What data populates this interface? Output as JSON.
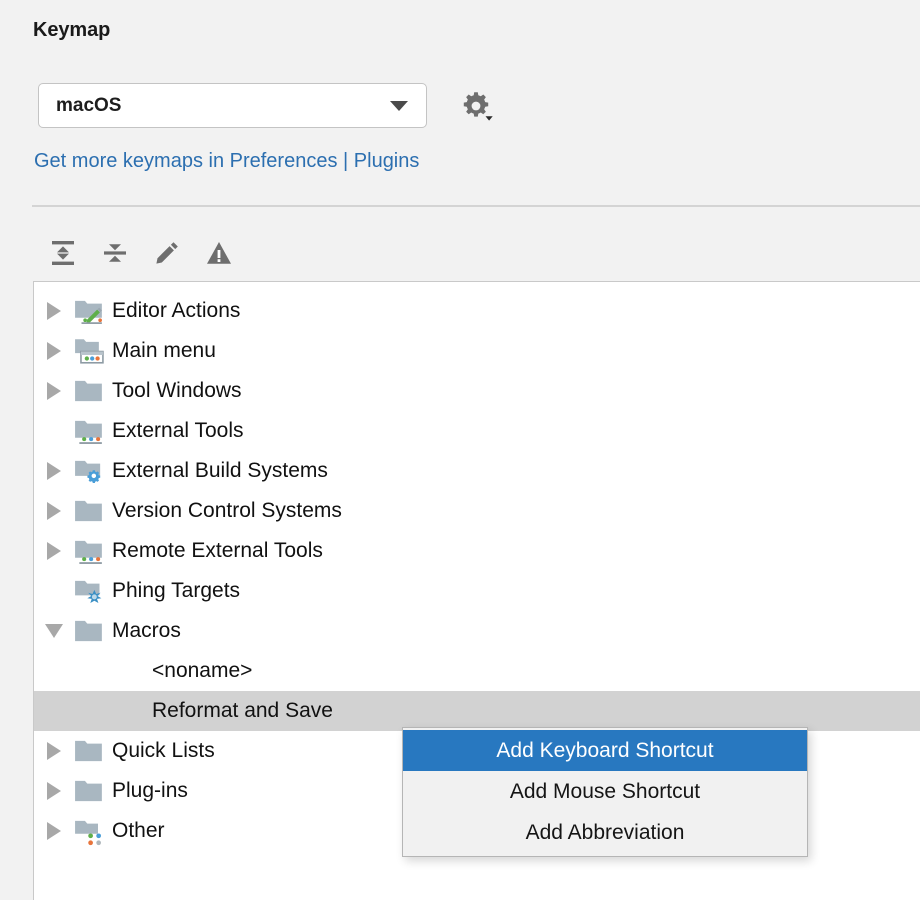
{
  "header": {
    "title": "Keymap"
  },
  "keymap_select": {
    "value": "macOS",
    "arrow_icon": "chevron-down-icon",
    "gear_icon": "gear-icon"
  },
  "link_line": {
    "text_before": "Get more keymaps in Preferences",
    "separator": " | ",
    "link_text": "Plugins"
  },
  "toolbar": {
    "buttons": [
      {
        "name": "expand-all-icon",
        "label": "Expand All"
      },
      {
        "name": "collapse-all-icon",
        "label": "Collapse All"
      },
      {
        "name": "edit-pencil-icon",
        "label": "Edit Shortcut"
      },
      {
        "name": "warning-icon",
        "label": "Show Conflicts"
      }
    ]
  },
  "tree": {
    "rows": [
      {
        "label": "Editor Actions",
        "twisty": "collapsed",
        "icon": "folder-pencil-icon",
        "type": "folder",
        "selected": false
      },
      {
        "label": "Main menu",
        "twisty": "collapsed",
        "icon": "folder-menu-icon",
        "type": "folder",
        "selected": false
      },
      {
        "label": "Tool Windows",
        "twisty": "collapsed",
        "icon": "folder-icon",
        "type": "folder",
        "selected": false
      },
      {
        "label": "External Tools",
        "twisty": "none",
        "icon": "folder-tools-icon",
        "type": "folder",
        "selected": false
      },
      {
        "label": "External Build Systems",
        "twisty": "collapsed",
        "icon": "folder-gear-icon",
        "type": "folder",
        "selected": false
      },
      {
        "label": "Version Control Systems",
        "twisty": "collapsed",
        "icon": "folder-icon",
        "type": "folder",
        "selected": false
      },
      {
        "label": "Remote External Tools",
        "twisty": "collapsed",
        "icon": "folder-tools-icon",
        "type": "folder",
        "selected": false
      },
      {
        "label": "Phing Targets",
        "twisty": "none",
        "icon": "folder-phing-icon",
        "type": "folder",
        "selected": false
      },
      {
        "label": "Macros",
        "twisty": "expanded",
        "icon": "folder-icon",
        "type": "folder",
        "selected": false
      },
      {
        "label": "<noname>",
        "twisty": "none",
        "icon": "none",
        "type": "child",
        "selected": false
      },
      {
        "label": "Reformat and Save",
        "twisty": "none",
        "icon": "none",
        "type": "child",
        "selected": true
      },
      {
        "label": "Quick Lists",
        "twisty": "collapsed",
        "icon": "folder-icon",
        "type": "folder",
        "selected": false
      },
      {
        "label": "Plug-ins",
        "twisty": "collapsed",
        "icon": "folder-icon",
        "type": "folder",
        "selected": false
      },
      {
        "label": "Other",
        "twisty": "collapsed",
        "icon": "folder-dots-icon",
        "type": "folder",
        "selected": false
      }
    ]
  },
  "context_menu": {
    "items": [
      {
        "label": "Add Keyboard Shortcut",
        "highlighted": true
      },
      {
        "label": "Add Mouse Shortcut",
        "highlighted": false
      },
      {
        "label": "Add Abbreviation",
        "highlighted": false
      }
    ]
  },
  "colors": {
    "link": "#2c6fb0",
    "selection_row": "#d2d2d2",
    "menu_highlight": "#2878c0",
    "background": "#f2f2f2",
    "tree_background": "#ffffff",
    "folder": "#a9b7c1"
  }
}
